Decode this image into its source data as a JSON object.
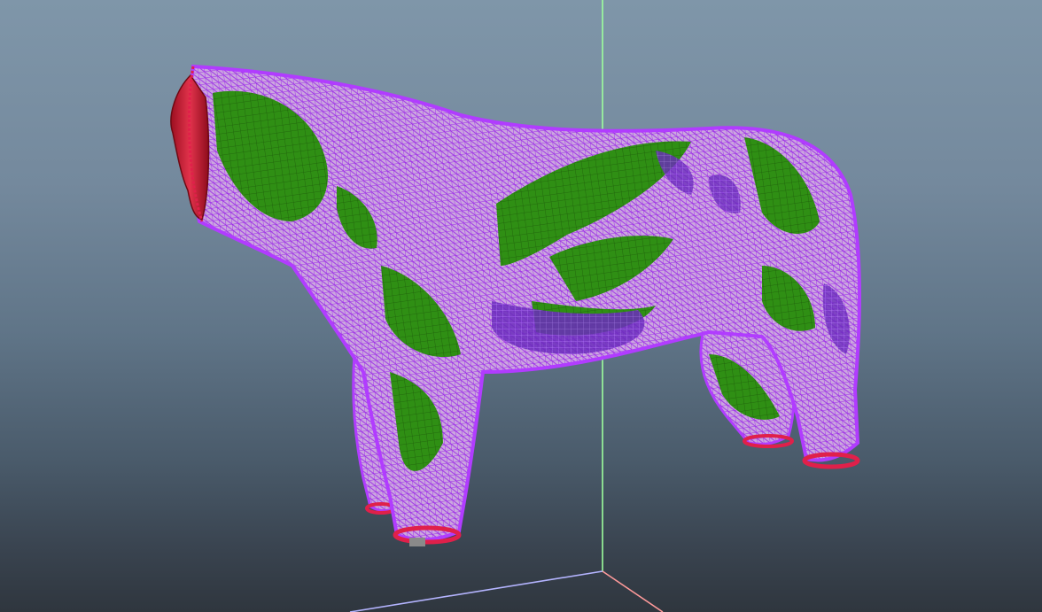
{
  "app": {
    "window": "3d-mesh-viewport"
  },
  "scene": {
    "model": "quadruped-mesh",
    "render_mode": "wireframe-over-shaded",
    "selection_style": "face-selection-highlight",
    "axes": [
      "x-axis",
      "y-axis",
      "z-axis"
    ]
  },
  "colors": {
    "background_top": "#7f96a9",
    "background_bottom": "#2f363e",
    "mesh_wire": "#a020f0",
    "mesh_fill": "#c39bd3",
    "selection": "#2d8a12",
    "dark_patch": "#6a2bb8",
    "open_edge": "#e0204a",
    "head_red": "#c2182e",
    "axis_y": "#9dff9d",
    "axis_x": "#ff8a8a",
    "axis_z": "#a9a9ff"
  }
}
